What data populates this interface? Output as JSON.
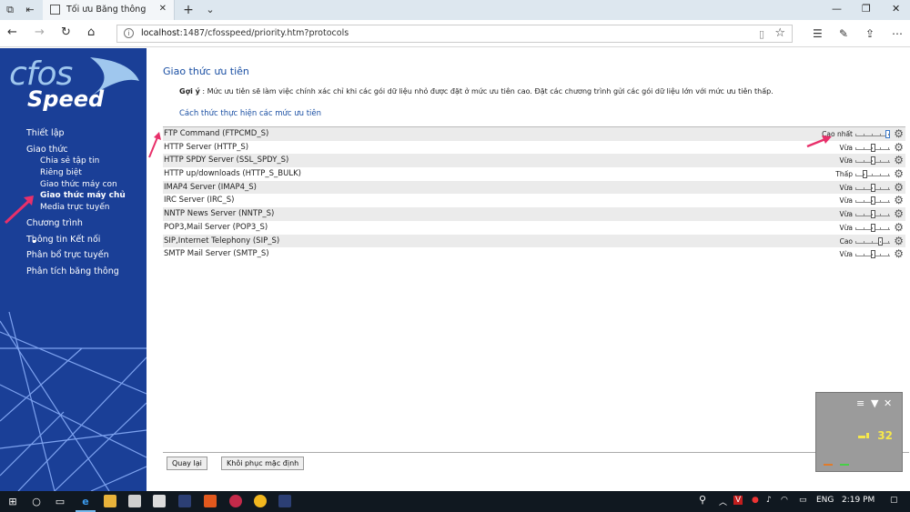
{
  "browser": {
    "tab_title": "Tối ưu Băng thông",
    "url_host": "localhost",
    "url_rest": ":1487/cfosspeed/priority.htm?protocols",
    "url_full": "localhost:1487/cfosspeed/priority.htm?protocols"
  },
  "logo": {
    "line1": "cfos",
    "line2": "Speed"
  },
  "sidebar": {
    "items": [
      {
        "label": "Thiết lập"
      },
      {
        "label": "Giao thức"
      },
      {
        "label": "Chia sẻ tập tin"
      },
      {
        "label": "Riêng biệt"
      },
      {
        "label": "Giao thức máy con"
      },
      {
        "label": "Giao thức máy chủ"
      },
      {
        "label": "Media trực tuyến"
      },
      {
        "label": "Chương trình"
      },
      {
        "label": "Thông tin Kết nối"
      },
      {
        "label": "Phân bổ trực tuyến"
      },
      {
        "label": "Phân tích băng thông"
      }
    ]
  },
  "main": {
    "title": "Giao thức ưu tiên",
    "tip_label": "Gợi ý",
    "tip_text": " : Mức ưu tiên sẽ làm việc chính xác chỉ khi các gói dữ liệu nhỏ được đặt ở mức ưu tiên cao. Đặt các chương trình gửi các gói dữ liệu lớn với mức ưu tiên thấp.",
    "howto_link": "Cách thức thực hiện các mức ưu tiên",
    "protocols": [
      {
        "name": "FTP Command (FTPCMD_S)",
        "level": "Cao nhất",
        "value": 1.0
      },
      {
        "name": "HTTP Server (HTTP_S)",
        "level": "Vừa",
        "value": 0.5
      },
      {
        "name": "HTTP SPDY Server (SSL_SPDY_S)",
        "level": "Vừa",
        "value": 0.5
      },
      {
        "name": "HTTP up/downloads (HTTP_S_BULK)",
        "level": "Thấp",
        "value": 0.25
      },
      {
        "name": "IMAP4 Server (IMAP4_S)",
        "level": "Vừa",
        "value": 0.5
      },
      {
        "name": "IRC Server (IRC_S)",
        "level": "Vừa",
        "value": 0.5
      },
      {
        "name": "NNTP News Server (NNTP_S)",
        "level": "Vừa",
        "value": 0.5
      },
      {
        "name": "POP3,Mail Server (POP3_S)",
        "level": "Vừa",
        "value": 0.5
      },
      {
        "name": "SIP,Internet Telephony (SIP_S)",
        "level": "Cao",
        "value": 0.75
      },
      {
        "name": "SMTP Mail Server (SMTP_S)",
        "level": "Vừa",
        "value": 0.5
      }
    ],
    "back_button": "Quay lại",
    "restore_button": "Khôi phục mặc định"
  },
  "widget": {
    "value": "32"
  },
  "taskbar": {
    "language": "ENG",
    "time": "2:19 PM"
  },
  "colors": {
    "sidebar": "#1a3f97",
    "link": "#1a4fa3",
    "annotation_arrow": "#e8306a"
  }
}
